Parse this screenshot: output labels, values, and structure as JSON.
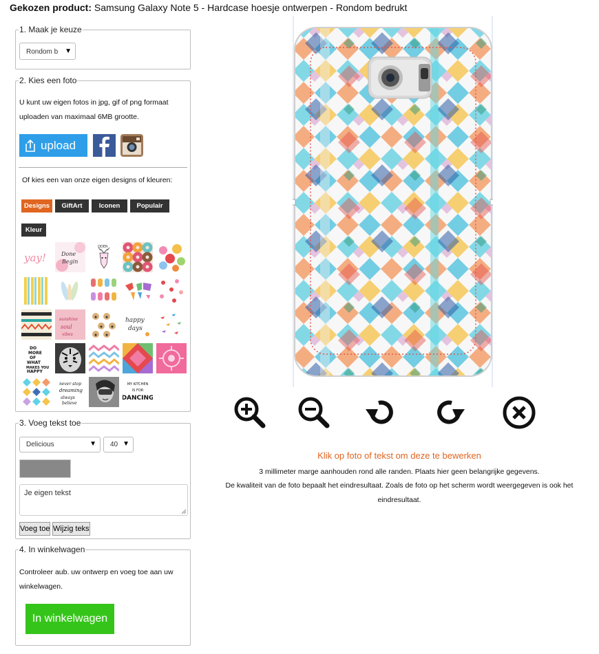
{
  "header": {
    "label": "Gekozen product:",
    "product": "Samsung Galaxy Note 5 - Hardcase hoesje ontwerpen - Rondom bedrukt"
  },
  "step1": {
    "legend": "1. Maak je keuze",
    "select_value": "Rondom b"
  },
  "step2": {
    "legend": "2. Kies een foto",
    "line1": "U kunt uw eigen fotos in jpg, gif of png formaat",
    "line2": "uploaden van maximaal 6MB grootte.",
    "upload_label": "upload",
    "designs_prompt": "Of kies een van onze eigen designs of kleuren:",
    "tabs": [
      "Designs",
      "GiftArt",
      "Iconen",
      "Populair",
      "Kleur"
    ],
    "active_tab": "Designs",
    "thumbnails": [
      {
        "name": "yay",
        "text": "yay!"
      },
      {
        "name": "done-begin",
        "text": "Done Begin"
      },
      {
        "name": "deer",
        "text": "ODER"
      },
      {
        "name": "donuts",
        "text": ""
      },
      {
        "name": "flowers",
        "text": ""
      },
      {
        "name": "stripes-dots",
        "text": ""
      },
      {
        "name": "feathers",
        "text": ""
      },
      {
        "name": "popsicles",
        "text": ""
      },
      {
        "name": "world-map",
        "text": ""
      },
      {
        "name": "florals-red",
        "text": ""
      },
      {
        "name": "aztec",
        "text": ""
      },
      {
        "name": "pink-quote",
        "text": ""
      },
      {
        "name": "pugs",
        "text": ""
      },
      {
        "name": "happy-days",
        "text": "happy days"
      },
      {
        "name": "birds",
        "text": ""
      },
      {
        "name": "do-more",
        "text": "DO MORE OF WHAT MAKES YOU HAPPY"
      },
      {
        "name": "tiger",
        "text": ""
      },
      {
        "name": "chevrons",
        "text": ""
      },
      {
        "name": "triangles",
        "text": ""
      },
      {
        "name": "pink-pattern",
        "text": ""
      },
      {
        "name": "diamonds",
        "text": ""
      },
      {
        "name": "script-quote",
        "text": ""
      },
      {
        "name": "girl-photo",
        "text": ""
      },
      {
        "name": "my-kitchen",
        "text": "MY KITCHEN IS FOR DANCING"
      }
    ]
  },
  "step3": {
    "legend": "3. Voeg tekst toe",
    "font_value": "Delicious",
    "size_value": "40",
    "text_placeholder": "Je eigen tekst",
    "add_label": "Voeg toe",
    "edit_label": "Wijzig tekst"
  },
  "step4": {
    "legend": "4. In winkelwagen",
    "line1": "Controleer aub. uw ontwerp en voeg toe aan uw",
    "line2": "winkelwagen.",
    "cart_label": "In winkelwagen"
  },
  "tools": [
    "zoom-in",
    "zoom-out",
    "rotate-left",
    "rotate-right",
    "delete"
  ],
  "notice": {
    "title": "Klik op foto of tekst om deze te bewerken",
    "line1": "3 millimeter marge aanhouden rond alle randen. Plaats hier geen belangrijke gegevens.",
    "line2": "De kwaliteit van de foto bepaalt het eindresultaat. Zoals de foto op het scherm wordt weergegeven is ook het",
    "line3": "eindresultaat."
  },
  "colors": {
    "accent": "#e06520",
    "upload": "#2e9ee8",
    "cart": "#35c51a",
    "tab": "#333333"
  }
}
